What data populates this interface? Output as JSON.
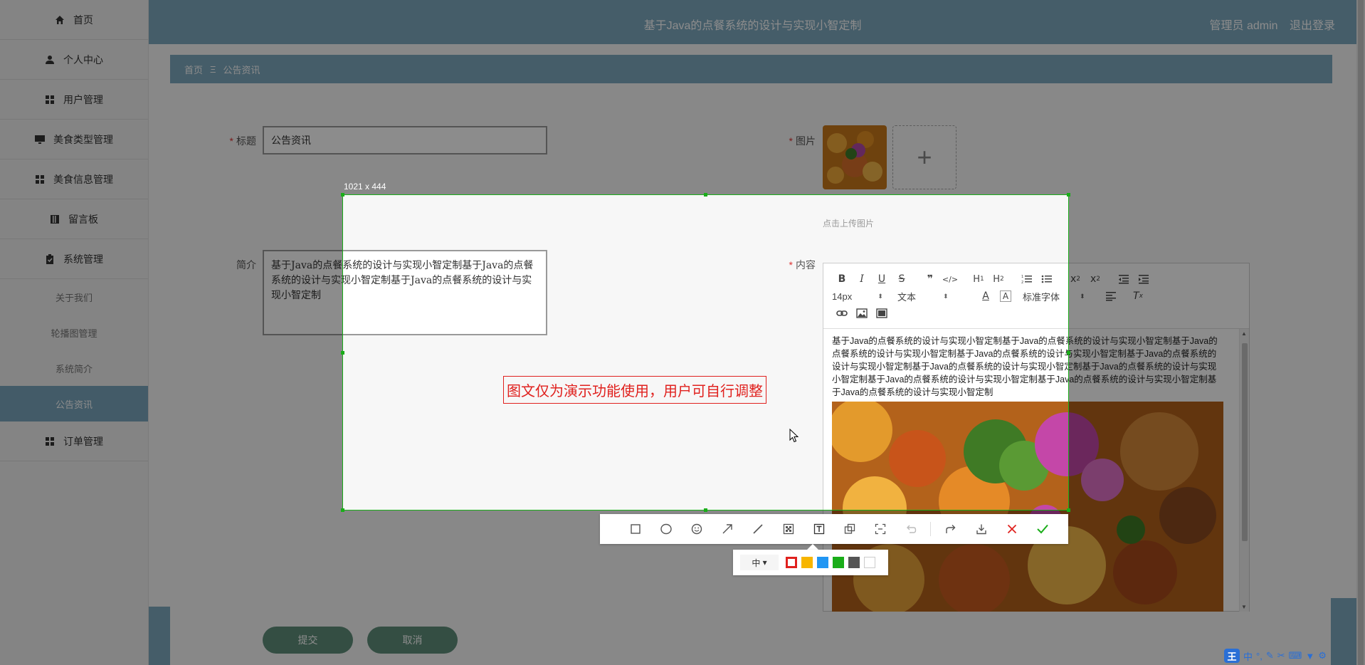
{
  "header": {
    "title": "基于Java的点餐系统的设计与实现小智定制",
    "user_label": "管理员 admin",
    "logout_label": "退出登录"
  },
  "sidebar": {
    "items": [
      {
        "label": "首页",
        "icon": "home-icon"
      },
      {
        "label": "个人中心",
        "icon": "user-icon"
      },
      {
        "label": "用户管理",
        "icon": "grid-icon"
      },
      {
        "label": "美食类型管理",
        "icon": "monitor-icon"
      },
      {
        "label": "美食信息管理",
        "icon": "grid-icon"
      },
      {
        "label": "留言板",
        "icon": "book-icon"
      },
      {
        "label": "系统管理",
        "icon": "clipboard-icon"
      }
    ],
    "sub_items": [
      {
        "label": "关于我们"
      },
      {
        "label": "轮播图管理"
      },
      {
        "label": "系统简介"
      },
      {
        "label": "公告资讯",
        "active": true
      }
    ],
    "last_item": {
      "label": "订单管理",
      "icon": "grid-icon"
    }
  },
  "breadcrumb": {
    "home": "首页",
    "separator": "Ξ",
    "current": "公告资讯"
  },
  "form": {
    "title_label": "标题",
    "title_value": "公告资讯",
    "image_label": "图片",
    "image_hint": "点击上传图片",
    "intro_label": "简介",
    "intro_value": "基于Java的点餐系统的设计与实现小智定制基于Java的点餐系统的设计与实现小智定制基于Java的点餐系统的设计与实现小智定制",
    "content_label": "内容",
    "content_text": "基于Java的点餐系统的设计与实现小智定制基于Java的点餐系统的设计与实现小智定制基于Java的点餐系统的设计与实现小智定制基于Java的点餐系统的设计与实现小智定制基于Java的点餐系统的设计与实现小智定制基于Java的点餐系统的设计与实现小智定制基于Java的点餐系统的设计与实现小智定制基于Java的点餐系统的设计与实现小智定制基于Java的点餐系统的设计与实现小智定制基于Java的点餐系统的设计与实现小智定制",
    "submit_label": "提交",
    "cancel_label": "取消"
  },
  "editor": {
    "toolbar_row1": [
      "B",
      "I",
      "U",
      "S",
      "❞",
      "</>",
      "H1",
      "H2",
      "ol",
      "ul",
      "x₂",
      "x²",
      "outdent",
      "indent"
    ],
    "font_size": "14px",
    "text_type": "文本",
    "font_family": "标准字体"
  },
  "screenshot": {
    "size_label": "1021 x 444",
    "annotation_text": "图文仅为演示功能使用，用户可自行调整",
    "pen_size": "中",
    "colors": [
      "#e0211e",
      "#f7b500",
      "#2196f3",
      "#1aad19",
      "#555555",
      "#ffffff"
    ],
    "selected_color": "#e0211e",
    "tools": [
      "rect-icon",
      "ellipse-icon",
      "emoji-icon",
      "arrow-icon",
      "line-icon",
      "mosaic-icon",
      "text-icon",
      "copy-icon",
      "ocr-icon",
      "undo-icon",
      "share-icon",
      "save-icon",
      "cancel-icon",
      "confirm-icon"
    ]
  },
  "ime": {
    "logo": "王",
    "mode": "中",
    "punct": "°,"
  },
  "colors": {
    "accent": "#7fa9bf",
    "select_green": "#1aad19",
    "annotation_red": "#e0211e"
  }
}
